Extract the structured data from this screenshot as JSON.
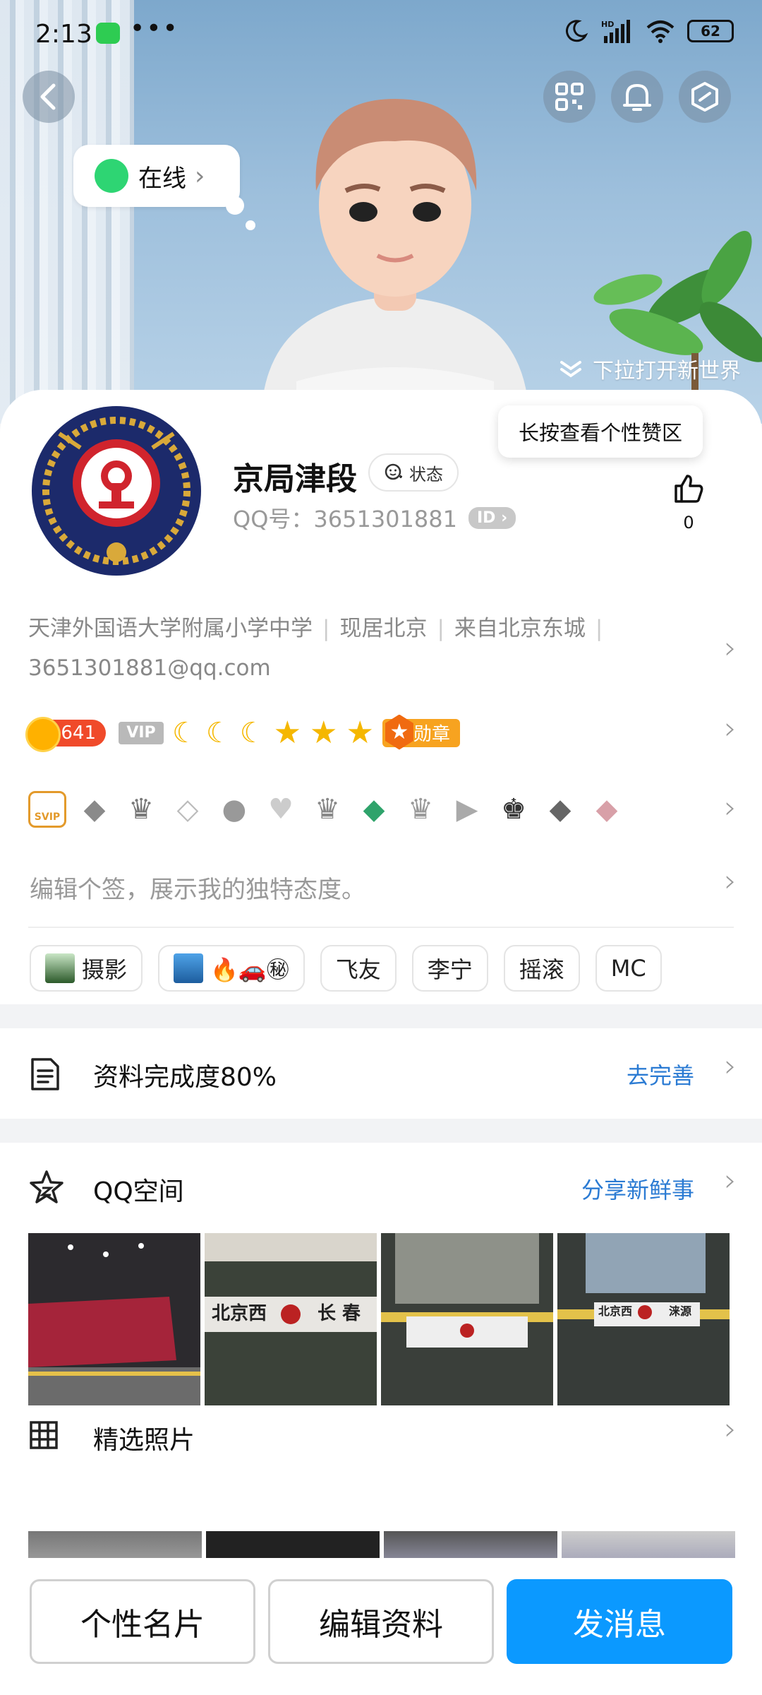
{
  "status_bar": {
    "time": "2:13",
    "dots": "•••",
    "battery": "62",
    "network": "HD"
  },
  "banner": {
    "online_status": "在线",
    "pull_hint": "下拉打开新世界"
  },
  "profile": {
    "nickname": "京局津段",
    "status_chip": "状态",
    "qq_label": "QQ号：3651301881",
    "id_badge": "ID",
    "like_tooltip": "长按查看个性赞区",
    "like_count": "0",
    "info": {
      "school": "天津外国语大学附属小学中学",
      "location": "现居北京",
      "hometown": "来自北京东城",
      "email": "3651301881@qq.com"
    },
    "level": "641",
    "vip": "VIP",
    "medal": "勋章",
    "svip": "SVIP",
    "signature": "编辑个签，展示我的独特态度。",
    "tags": [
      "摄影",
      "🔥🚗㊙",
      "飞友",
      "李宁",
      "摇滚",
      "MC"
    ]
  },
  "completeness": {
    "title": "资料完成度80%",
    "action": "去完善"
  },
  "qzone": {
    "title": "QQ空间",
    "action": "分享新鲜事"
  },
  "featured": {
    "title": "精选照片"
  },
  "bottom": {
    "card_label": "个性名片",
    "edit_label": "编辑资料",
    "message_label": "发消息"
  },
  "colors": {
    "primary": "#0b99ff",
    "link": "#2b7bd3",
    "online": "#2ed573"
  }
}
